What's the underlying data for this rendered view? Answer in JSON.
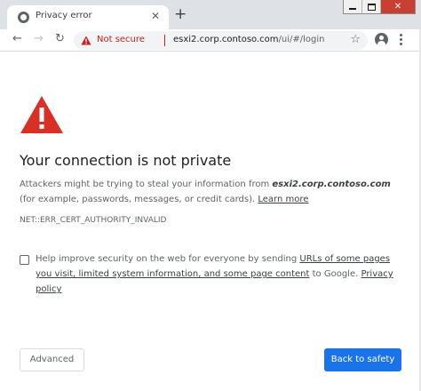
{
  "tab": {
    "title": "Privacy error",
    "close_glyph": "✕",
    "new_tab_glyph": "+"
  },
  "window_controls": {
    "close_glyph": "✕"
  },
  "toolbar": {
    "back_glyph": "←",
    "forward_glyph": "→",
    "reload_glyph": "↻",
    "security_label": "Not secure",
    "url_host": "esxi2.corp.contoso.com",
    "url_path": "/ui/#/login",
    "bookmark_glyph": "☆"
  },
  "interstitial": {
    "heading": "Your connection is not private",
    "desc_before": "Attackers might be trying to steal your information from ",
    "desc_host": "esxi2.corp.contoso.com",
    "desc_after": " (for example, passwords, messages, or credit cards). ",
    "learn_more": "Learn more",
    "error_code": "NET::ERR_CERT_AUTHORITY_INVALID",
    "optin_before": "Help improve security on the web for everyone by sending ",
    "optin_link": "URLs of some pages you visit, limited system information, and some page content",
    "optin_middle": " to Google. ",
    "privacy_policy": "Privacy policy",
    "optin_checked": false,
    "advanced_label": "Advanced",
    "back_label": "Back to safety"
  },
  "colors": {
    "warning_red": "#d93025",
    "primary_blue": "#1a73e8",
    "not_secure_red": "#c5221f"
  },
  "icons": {
    "tab_favicon": "globe-icon",
    "security": "warning-triangle-icon",
    "profile": "account-circle-icon",
    "menu": "kebab-menu-icon",
    "main": "warning-triangle-icon"
  }
}
